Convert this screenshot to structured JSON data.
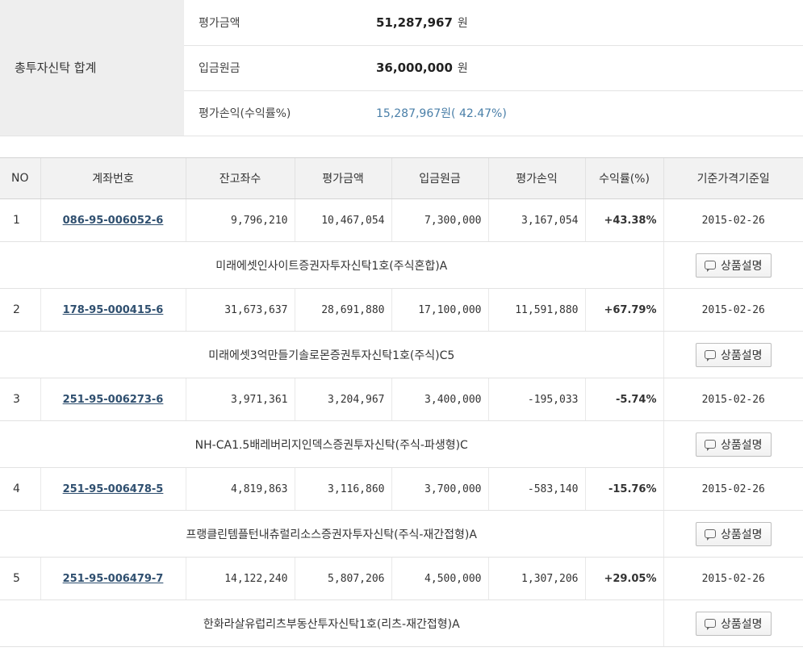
{
  "summary": {
    "header": "총투자신탁 합계",
    "eval_amount_label": "평가금액",
    "eval_amount": "51,287,967",
    "deposit_label": "입금원금",
    "deposit": "36,000,000",
    "profit_label": "평가손익(수익률%)",
    "profit_value": "15,287,967원( 42.47%)",
    "unit": "원"
  },
  "columns": [
    "NO",
    "계좌번호",
    "잔고좌수",
    "평가금액",
    "입금원금",
    "평가손익",
    "수익률(%)",
    "기준가격기준일"
  ],
  "button_label": "상품설명",
  "rows": [
    {
      "no": "1",
      "account": "086-95-006052-6",
      "units": "9,796,210",
      "eval": "10,467,054",
      "deposit": "7,300,000",
      "pl": "3,167,054",
      "rate": "+43.38%",
      "date": "2015-02-26",
      "fund": "미래에셋인사이트증권자투자신탁1호(주식혼합)A"
    },
    {
      "no": "2",
      "account": "178-95-000415-6",
      "units": "31,673,637",
      "eval": "28,691,880",
      "deposit": "17,100,000",
      "pl": "11,591,880",
      "rate": "+67.79%",
      "date": "2015-02-26",
      "fund": "미래에셋3억만들기솔로몬증권투자신탁1호(주식)C5"
    },
    {
      "no": "3",
      "account": "251-95-006273-6",
      "units": "3,971,361",
      "eval": "3,204,967",
      "deposit": "3,400,000",
      "pl": "-195,033",
      "rate": "-5.74%",
      "date": "2015-02-26",
      "fund": "NH-CA1.5배레버리지인덱스증권투자신탁(주식-파생형)C"
    },
    {
      "no": "4",
      "account": "251-95-006478-5",
      "units": "4,819,863",
      "eval": "3,116,860",
      "deposit": "3,700,000",
      "pl": "-583,140",
      "rate": "-15.76%",
      "date": "2015-02-26",
      "fund": "프랭클린템플턴내츄럴리소스증권자투자신탁(주식-재간접형)A"
    },
    {
      "no": "5",
      "account": "251-95-006479-7",
      "units": "14,122,240",
      "eval": "5,807,206",
      "deposit": "4,500,000",
      "pl": "1,307,206",
      "rate": "+29.05%",
      "date": "2015-02-26",
      "fund": "한화라살유럽리츠부동산투자신탁1호(리츠-재간접형)A"
    }
  ],
  "colors": {
    "positive": "#d43838",
    "negative": "#3c8ad9",
    "header_bg": "#eeeeee"
  }
}
